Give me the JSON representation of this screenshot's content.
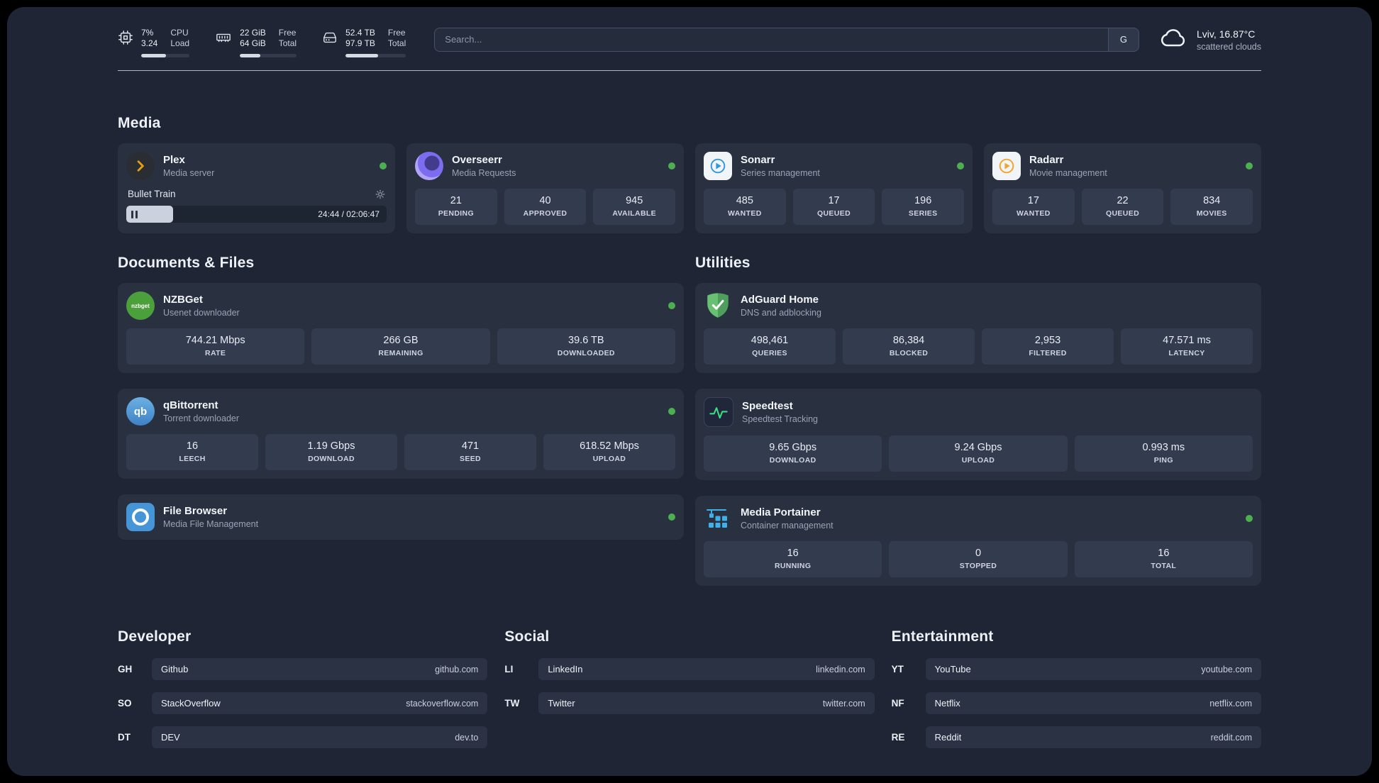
{
  "colors": {
    "background": "#1f2535",
    "card": "#293040",
    "stat_box": "#333b4e",
    "status_online": "#4caf50",
    "plex_gold": "#e5a00d"
  },
  "topbar": {
    "cpu": {
      "value_top": "7%",
      "value_bottom": "3.24",
      "label_top": "CPU",
      "label_bottom": "Load",
      "progress": 52
    },
    "ram": {
      "value_top": "22 GiB",
      "value_bottom": "64 GiB",
      "label_top": "Free",
      "label_bottom": "Total",
      "progress": 36
    },
    "disk": {
      "value_top": "52.4 TB",
      "value_bottom": "97.9 TB",
      "label_top": "Free",
      "label_bottom": "Total",
      "progress": 54
    },
    "search": {
      "placeholder": "Search...",
      "engine_label": "G"
    },
    "weather": {
      "location": "Lviv, 16.87°C",
      "condition": "scattered clouds"
    }
  },
  "sections": {
    "media": "Media",
    "documents": "Documents & Files",
    "utilities": "Utilities",
    "developer": "Developer",
    "social": "Social",
    "entertainment": "Entertainment"
  },
  "apps": {
    "plex": {
      "name": "Plex",
      "subtitle": "Media server",
      "status": "online",
      "player_title": "Bullet Train",
      "player_time": "24:44 / 02:06:47",
      "player_progress": 16
    },
    "overseerr": {
      "name": "Overseerr",
      "subtitle": "Media Requests",
      "status": "online",
      "stats": [
        {
          "value": "21",
          "label": "PENDING"
        },
        {
          "value": "40",
          "label": "APPROVED"
        },
        {
          "value": "945",
          "label": "AVAILABLE"
        }
      ]
    },
    "sonarr": {
      "name": "Sonarr",
      "subtitle": "Series management",
      "status": "online",
      "stats": [
        {
          "value": "485",
          "label": "WANTED"
        },
        {
          "value": "17",
          "label": "QUEUED"
        },
        {
          "value": "196",
          "label": "SERIES"
        }
      ]
    },
    "radarr": {
      "name": "Radarr",
      "subtitle": "Movie management",
      "status": "online",
      "stats": [
        {
          "value": "17",
          "label": "WANTED"
        },
        {
          "value": "22",
          "label": "QUEUED"
        },
        {
          "value": "834",
          "label": "MOVIES"
        }
      ]
    },
    "nzbget": {
      "name": "NZBGet",
      "subtitle": "Usenet downloader",
      "status": "online",
      "icon_text": "nzbget",
      "stats": [
        {
          "value": "744.21 Mbps",
          "label": "RATE"
        },
        {
          "value": "266 GB",
          "label": "REMAINING"
        },
        {
          "value": "39.6 TB",
          "label": "DOWNLOADED"
        }
      ]
    },
    "qbittorrent": {
      "name": "qBittorrent",
      "subtitle": "Torrent downloader",
      "status": "online",
      "icon_text": "qb",
      "stats": [
        {
          "value": "16",
          "label": "LEECH"
        },
        {
          "value": "1.19 Gbps",
          "label": "DOWNLOAD"
        },
        {
          "value": "471",
          "label": "SEED"
        },
        {
          "value": "618.52 Mbps",
          "label": "UPLOAD"
        }
      ]
    },
    "filebrowser": {
      "name": "File Browser",
      "subtitle": "Media File Management",
      "status": "online"
    },
    "adguard": {
      "name": "AdGuard Home",
      "subtitle": "DNS and adblocking",
      "stats": [
        {
          "value": "498,461",
          "label": "QUERIES"
        },
        {
          "value": "86,384",
          "label": "BLOCKED"
        },
        {
          "value": "2,953",
          "label": "FILTERED"
        },
        {
          "value": "47.571 ms",
          "label": "LATENCY"
        }
      ]
    },
    "speedtest": {
      "name": "Speedtest",
      "subtitle": "Speedtest Tracking",
      "stats": [
        {
          "value": "9.65 Gbps",
          "label": "DOWNLOAD"
        },
        {
          "value": "9.24 Gbps",
          "label": "UPLOAD"
        },
        {
          "value": "0.993 ms",
          "label": "PING"
        }
      ]
    },
    "portainer": {
      "name": "Media Portainer",
      "subtitle": "Container management",
      "status": "online",
      "stats": [
        {
          "value": "16",
          "label": "RUNNING"
        },
        {
          "value": "0",
          "label": "STOPPED"
        },
        {
          "value": "16",
          "label": "TOTAL"
        }
      ]
    }
  },
  "links": {
    "developer": [
      {
        "abbr": "GH",
        "name": "Github",
        "url": "github.com"
      },
      {
        "abbr": "SO",
        "name": "StackOverflow",
        "url": "stackoverflow.com"
      },
      {
        "abbr": "DT",
        "name": "DEV",
        "url": "dev.to"
      }
    ],
    "social": [
      {
        "abbr": "LI",
        "name": "LinkedIn",
        "url": "linkedin.com"
      },
      {
        "abbr": "TW",
        "name": "Twitter",
        "url": "twitter.com"
      }
    ],
    "entertainment": [
      {
        "abbr": "YT",
        "name": "YouTube",
        "url": "youtube.com"
      },
      {
        "abbr": "NF",
        "name": "Netflix",
        "url": "netflix.com"
      },
      {
        "abbr": "RE",
        "name": "Reddit",
        "url": "reddit.com"
      }
    ]
  }
}
